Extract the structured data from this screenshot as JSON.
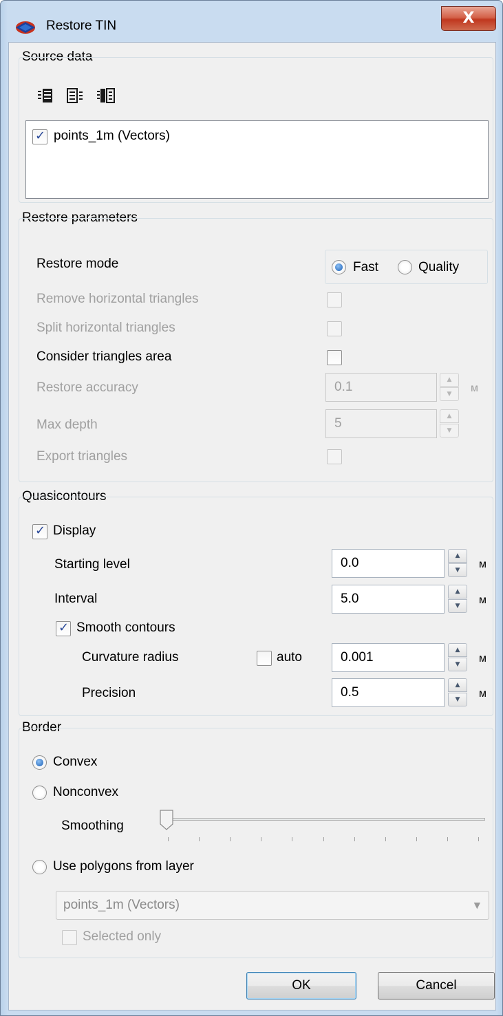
{
  "window": {
    "title": "Restore TIN",
    "close_glyph": "X"
  },
  "source_data": {
    "title": "Source data",
    "toolbar_icons": [
      "select-all-icon",
      "deselect-all-icon",
      "invert-selection-icon"
    ],
    "items": [
      {
        "label": "points_1m (Vectors)",
        "checked": true
      }
    ]
  },
  "restore_parameters": {
    "title": "Restore parameters",
    "restore_mode_label": "Restore mode",
    "mode_fast": "Fast",
    "mode_quality": "Quality",
    "selected_mode": "Fast",
    "remove_horizontal": "Remove horizontal triangles",
    "split_horizontal": "Split horizontal triangles",
    "consider_area": "Consider triangles area",
    "accuracy_label": "Restore accuracy",
    "accuracy_value": "0.1",
    "accuracy_unit": "м",
    "max_depth_label": "Max depth",
    "max_depth_value": "5",
    "export_triangles": "Export triangles"
  },
  "quasicontours": {
    "title": "Quasicontours",
    "display_label": "Display",
    "display_checked": true,
    "starting_level_label": "Starting level",
    "starting_level_value": "0.0",
    "interval_label": "Interval",
    "interval_value": "5.0",
    "smooth_label": "Smooth contours",
    "smooth_checked": true,
    "curvature_label": "Curvature radius",
    "auto_label": "auto",
    "curvature_value": "0.001",
    "precision_label": "Precision",
    "precision_value": "0.5",
    "unit": "м"
  },
  "border": {
    "title": "Border",
    "convex": "Convex",
    "nonconvex": "Nonconvex",
    "selected": "Convex",
    "smoothing_label": "Smoothing",
    "smoothing_level": 0,
    "use_polygons": "Use polygons from layer",
    "layer_value": "points_1m (Vectors)",
    "selected_only": "Selected only"
  },
  "buttons": {
    "ok": "OK",
    "cancel": "Cancel"
  },
  "colors": {
    "accent_radio": "#1b5fb5",
    "close_button": "#c0381f",
    "frame": "#c9dcf0"
  }
}
